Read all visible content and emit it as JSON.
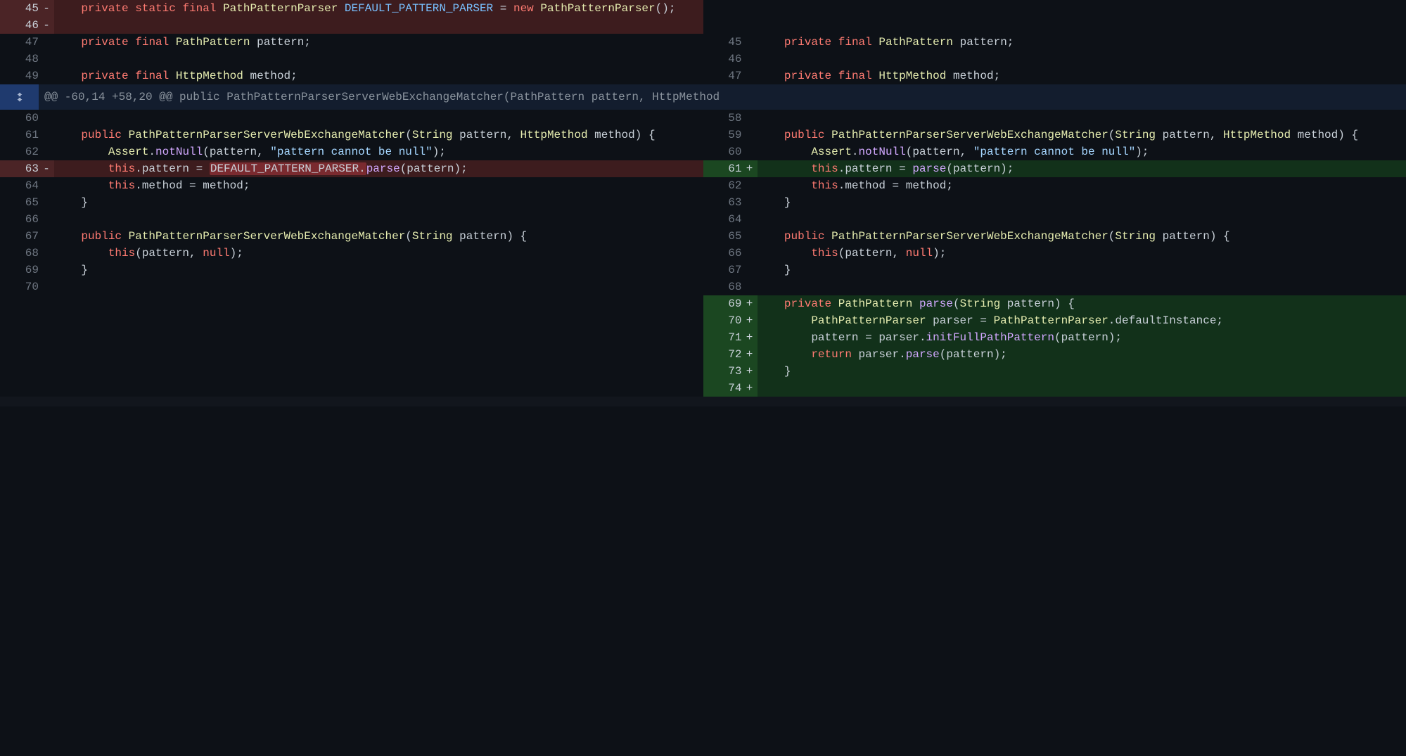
{
  "hunk_header": "@@ -60,14 +58,20 @@ public PathPatternParserServerWebExchangeMatcher(PathPattern pattern, HttpMethod",
  "rows": [
    {
      "left": {
        "type": "del",
        "no": "45",
        "marker": "-",
        "tokens": [
          {
            "t": "    ",
            "c": ""
          },
          {
            "t": "private",
            "c": "k"
          },
          {
            "t": " ",
            "c": ""
          },
          {
            "t": "static",
            "c": "k"
          },
          {
            "t": " ",
            "c": ""
          },
          {
            "t": "final",
            "c": "k"
          },
          {
            "t": " ",
            "c": ""
          },
          {
            "t": "PathPatternParser",
            "c": "ty"
          },
          {
            "t": " ",
            "c": ""
          },
          {
            "t": "DEFAULT_PATTERN_PARSER",
            "c": "cnst"
          },
          {
            "t": " = ",
            "c": ""
          },
          {
            "t": "new",
            "c": "k"
          },
          {
            "t": " ",
            "c": ""
          },
          {
            "t": "PathPatternParser",
            "c": "ty"
          },
          {
            "t": "();",
            "c": ""
          }
        ]
      },
      "right": {
        "type": "empty"
      }
    },
    {
      "left": {
        "type": "del",
        "no": "46",
        "marker": "-",
        "tokens": []
      },
      "right": {
        "type": "empty"
      }
    },
    {
      "left": {
        "type": "ctx",
        "no": "47",
        "marker": "",
        "tokens": [
          {
            "t": "    ",
            "c": ""
          },
          {
            "t": "private",
            "c": "k"
          },
          {
            "t": " ",
            "c": ""
          },
          {
            "t": "final",
            "c": "k"
          },
          {
            "t": " ",
            "c": ""
          },
          {
            "t": "PathPattern",
            "c": "ty"
          },
          {
            "t": " ",
            "c": ""
          },
          {
            "t": "pattern",
            ";": ""
          },
          {
            "t": ";",
            "c": ""
          }
        ]
      },
      "right": {
        "type": "ctx",
        "no": "45",
        "marker": "",
        "tokens": [
          {
            "t": "    ",
            "c": ""
          },
          {
            "t": "private",
            "c": "k"
          },
          {
            "t": " ",
            "c": ""
          },
          {
            "t": "final",
            "c": "k"
          },
          {
            "t": " ",
            "c": ""
          },
          {
            "t": "PathPattern",
            "c": "ty"
          },
          {
            "t": " ",
            "c": ""
          },
          {
            "t": "pattern",
            "c": ""
          },
          {
            "t": ";",
            "c": ""
          }
        ]
      }
    },
    {
      "left": {
        "type": "ctx",
        "no": "48",
        "marker": "",
        "tokens": []
      },
      "right": {
        "type": "ctx",
        "no": "46",
        "marker": "",
        "tokens": []
      }
    },
    {
      "left": {
        "type": "ctx",
        "no": "49",
        "marker": "",
        "tokens": [
          {
            "t": "    ",
            "c": ""
          },
          {
            "t": "private",
            "c": "k"
          },
          {
            "t": " ",
            "c": ""
          },
          {
            "t": "final",
            "c": "k"
          },
          {
            "t": " ",
            "c": ""
          },
          {
            "t": "HttpMethod",
            "c": "ty"
          },
          {
            "t": " ",
            "c": ""
          },
          {
            "t": "method",
            "c": ""
          },
          {
            "t": ";",
            "c": ""
          }
        ]
      },
      "right": {
        "type": "ctx",
        "no": "47",
        "marker": "",
        "tokens": [
          {
            "t": "    ",
            "c": ""
          },
          {
            "t": "private",
            "c": "k"
          },
          {
            "t": " ",
            "c": ""
          },
          {
            "t": "final",
            "c": "k"
          },
          {
            "t": " ",
            "c": ""
          },
          {
            "t": "HttpMethod",
            "c": "ty"
          },
          {
            "t": " ",
            "c": ""
          },
          {
            "t": "method",
            "c": ""
          },
          {
            "t": ";",
            "c": ""
          }
        ]
      }
    },
    {
      "hunk": true
    },
    {
      "left": {
        "type": "ctx",
        "no": "60",
        "marker": "",
        "tokens": []
      },
      "right": {
        "type": "ctx",
        "no": "58",
        "marker": "",
        "tokens": []
      }
    },
    {
      "left": {
        "type": "ctx",
        "no": "61",
        "marker": "",
        "tokens": [
          {
            "t": "    ",
            "c": ""
          },
          {
            "t": "public",
            "c": "k"
          },
          {
            "t": " ",
            "c": ""
          },
          {
            "t": "PathPatternParserServerWebExchangeMatcher",
            "c": "ty"
          },
          {
            "t": "(",
            "c": ""
          },
          {
            "t": "String",
            "c": "ty"
          },
          {
            "t": " pattern, ",
            "c": ""
          },
          {
            "t": "HttpMethod",
            "c": "ty"
          },
          {
            "t": " method) {",
            "c": ""
          }
        ]
      },
      "right": {
        "type": "ctx",
        "no": "59",
        "marker": "",
        "tokens": [
          {
            "t": "    ",
            "c": ""
          },
          {
            "t": "public",
            "c": "k"
          },
          {
            "t": " ",
            "c": ""
          },
          {
            "t": "PathPatternParserServerWebExchangeMatcher",
            "c": "ty"
          },
          {
            "t": "(",
            "c": ""
          },
          {
            "t": "String",
            "c": "ty"
          },
          {
            "t": " pattern, ",
            "c": ""
          },
          {
            "t": "HttpMethod",
            "c": "ty"
          },
          {
            "t": " method) {",
            "c": ""
          }
        ]
      }
    },
    {
      "left": {
        "type": "ctx",
        "no": "62",
        "marker": "",
        "tokens": [
          {
            "t": "        ",
            "c": ""
          },
          {
            "t": "Assert",
            "c": "ty"
          },
          {
            "t": ".",
            "c": ""
          },
          {
            "t": "notNull",
            "c": "fn"
          },
          {
            "t": "(pattern, ",
            "c": ""
          },
          {
            "t": "\"pattern cannot be null\"",
            "c": "s"
          },
          {
            "t": ");",
            "c": ""
          }
        ]
      },
      "right": {
        "type": "ctx",
        "no": "60",
        "marker": "",
        "tokens": [
          {
            "t": "        ",
            "c": ""
          },
          {
            "t": "Assert",
            "c": "ty"
          },
          {
            "t": ".",
            "c": ""
          },
          {
            "t": "notNull",
            "c": "fn"
          },
          {
            "t": "(pattern, ",
            "c": ""
          },
          {
            "t": "\"pattern cannot be null\"",
            "c": "s"
          },
          {
            "t": ");",
            "c": ""
          }
        ]
      }
    },
    {
      "left": {
        "type": "del-strong",
        "no": "63",
        "marker": "-",
        "tokens": [
          {
            "t": "        ",
            "c": ""
          },
          {
            "t": "this",
            "c": "k"
          },
          {
            "t": ".pattern = ",
            "c": ""
          },
          {
            "t": "DEFAULT_PATTERN_PARSER.",
            "c": "",
            "hl": "del"
          },
          {
            "t": "parse",
            "c": "fn"
          },
          {
            "t": "(pattern);",
            "c": ""
          }
        ]
      },
      "right": {
        "type": "add",
        "no": "61",
        "marker": "+",
        "tokens": [
          {
            "t": "        ",
            "c": ""
          },
          {
            "t": "this",
            "c": "k"
          },
          {
            "t": ".pattern = ",
            "c": ""
          },
          {
            "t": "parse",
            "c": "fn"
          },
          {
            "t": "(pattern);",
            "c": ""
          }
        ]
      }
    },
    {
      "left": {
        "type": "ctx",
        "no": "64",
        "marker": "",
        "tokens": [
          {
            "t": "        ",
            "c": ""
          },
          {
            "t": "this",
            "c": "k"
          },
          {
            "t": ".method = method;",
            "c": ""
          }
        ]
      },
      "right": {
        "type": "ctx",
        "no": "62",
        "marker": "",
        "tokens": [
          {
            "t": "        ",
            "c": ""
          },
          {
            "t": "this",
            "c": "k"
          },
          {
            "t": ".method = method;",
            "c": ""
          }
        ]
      }
    },
    {
      "left": {
        "type": "ctx",
        "no": "65",
        "marker": "",
        "tokens": [
          {
            "t": "    }",
            "c": ""
          }
        ]
      },
      "right": {
        "type": "ctx",
        "no": "63",
        "marker": "",
        "tokens": [
          {
            "t": "    }",
            "c": ""
          }
        ]
      }
    },
    {
      "left": {
        "type": "ctx",
        "no": "66",
        "marker": "",
        "tokens": []
      },
      "right": {
        "type": "ctx",
        "no": "64",
        "marker": "",
        "tokens": []
      }
    },
    {
      "left": {
        "type": "ctx",
        "no": "67",
        "marker": "",
        "tokens": [
          {
            "t": "    ",
            "c": ""
          },
          {
            "t": "public",
            "c": "k"
          },
          {
            "t": " ",
            "c": ""
          },
          {
            "t": "PathPatternParserServerWebExchangeMatcher",
            "c": "ty"
          },
          {
            "t": "(",
            "c": ""
          },
          {
            "t": "String",
            "c": "ty"
          },
          {
            "t": " pattern) {",
            "c": ""
          }
        ]
      },
      "right": {
        "type": "ctx",
        "no": "65",
        "marker": "",
        "tokens": [
          {
            "t": "    ",
            "c": ""
          },
          {
            "t": "public",
            "c": "k"
          },
          {
            "t": " ",
            "c": ""
          },
          {
            "t": "PathPatternParserServerWebExchangeMatcher",
            "c": "ty"
          },
          {
            "t": "(",
            "c": ""
          },
          {
            "t": "String",
            "c": "ty"
          },
          {
            "t": " pattern) {",
            "c": ""
          }
        ]
      }
    },
    {
      "left": {
        "type": "ctx",
        "no": "68",
        "marker": "",
        "tokens": [
          {
            "t": "        ",
            "c": ""
          },
          {
            "t": "this",
            "c": "k"
          },
          {
            "t": "(pattern, ",
            "c": ""
          },
          {
            "t": "null",
            "c": "k"
          },
          {
            "t": ");",
            "c": ""
          }
        ]
      },
      "right": {
        "type": "ctx",
        "no": "66",
        "marker": "",
        "tokens": [
          {
            "t": "        ",
            "c": ""
          },
          {
            "t": "this",
            "c": "k"
          },
          {
            "t": "(pattern, ",
            "c": ""
          },
          {
            "t": "null",
            "c": "k"
          },
          {
            "t": ");",
            "c": ""
          }
        ]
      }
    },
    {
      "left": {
        "type": "ctx",
        "no": "69",
        "marker": "",
        "tokens": [
          {
            "t": "    }",
            "c": ""
          }
        ]
      },
      "right": {
        "type": "ctx",
        "no": "67",
        "marker": "",
        "tokens": [
          {
            "t": "    }",
            "c": ""
          }
        ]
      }
    },
    {
      "left": {
        "type": "ctx",
        "no": "70",
        "marker": "",
        "tokens": []
      },
      "right": {
        "type": "ctx",
        "no": "68",
        "marker": "",
        "tokens": []
      }
    },
    {
      "left": {
        "type": "empty"
      },
      "right": {
        "type": "add",
        "no": "69",
        "marker": "+",
        "tokens": [
          {
            "t": "    ",
            "c": ""
          },
          {
            "t": "private",
            "c": "k"
          },
          {
            "t": " ",
            "c": ""
          },
          {
            "t": "PathPattern",
            "c": "ty"
          },
          {
            "t": " ",
            "c": ""
          },
          {
            "t": "parse",
            "c": "fn"
          },
          {
            "t": "(",
            "c": ""
          },
          {
            "t": "String",
            "c": "ty"
          },
          {
            "t": " pattern) {",
            "c": ""
          }
        ]
      }
    },
    {
      "left": {
        "type": "empty"
      },
      "right": {
        "type": "add",
        "no": "70",
        "marker": "+",
        "tokens": [
          {
            "t": "        ",
            "c": ""
          },
          {
            "t": "PathPatternParser",
            "c": "ty"
          },
          {
            "t": " parser = ",
            "c": ""
          },
          {
            "t": "PathPatternParser",
            "c": "ty"
          },
          {
            "t": ".defaultInstance;",
            "c": ""
          }
        ]
      }
    },
    {
      "left": {
        "type": "empty"
      },
      "right": {
        "type": "add",
        "no": "71",
        "marker": "+",
        "tokens": [
          {
            "t": "        pattern = parser.",
            "c": ""
          },
          {
            "t": "initFullPathPattern",
            "c": "fn"
          },
          {
            "t": "(pattern);",
            "c": ""
          }
        ]
      }
    },
    {
      "left": {
        "type": "empty"
      },
      "right": {
        "type": "add",
        "no": "72",
        "marker": "+",
        "tokens": [
          {
            "t": "        ",
            "c": ""
          },
          {
            "t": "return",
            "c": "k"
          },
          {
            "t": " parser.",
            "c": ""
          },
          {
            "t": "parse",
            "c": "fn"
          },
          {
            "t": "(pattern);",
            "c": ""
          }
        ]
      }
    },
    {
      "left": {
        "type": "empty"
      },
      "right": {
        "type": "add",
        "no": "73",
        "marker": "+",
        "tokens": [
          {
            "t": "    }",
            "c": ""
          }
        ]
      }
    },
    {
      "left": {
        "type": "empty"
      },
      "right": {
        "type": "add",
        "no": "74",
        "marker": "+",
        "tokens": []
      }
    }
  ]
}
